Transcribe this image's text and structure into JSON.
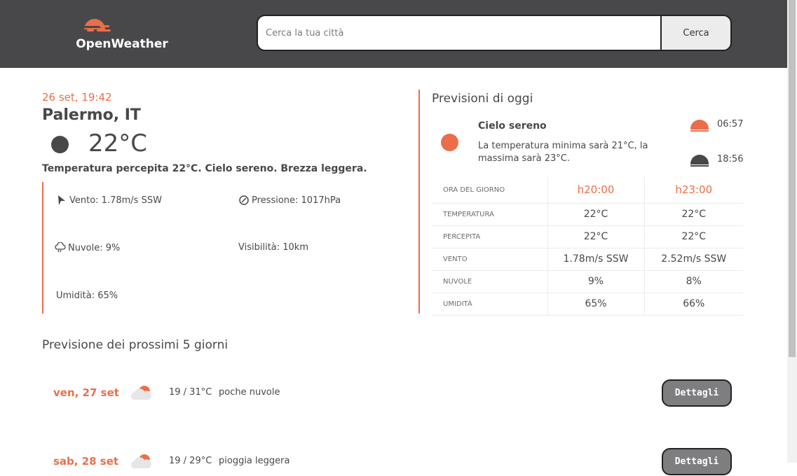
{
  "header": {
    "logo_text": "OpenWeather",
    "search_placeholder": "Cerca la tua città",
    "search_button": "Cerca"
  },
  "current": {
    "date": "26 set, 19:42",
    "city": "Palermo, IT",
    "temperature": "22°C",
    "description": "Temperatura percepita 22°C. Cielo sereno. Brezza leggera.",
    "wind": "Vento: 1.78m/s SSW",
    "pressure": "Pressione: 1017hPa",
    "clouds": "Nuvole: 9%",
    "visibility": "Visibilità: 10km",
    "humidity": "Umidità: 65%"
  },
  "today": {
    "title": "Previsioni di oggi",
    "summary": "Cielo sereno",
    "text": "La temperatura minima sarà 21°C, la massima sarà 23°C.",
    "sunrise": "06:57",
    "sunset": "18:56",
    "table": {
      "rows": [
        {
          "label": "ORA DEL GIORNO",
          "v1": "h20:00",
          "v2": "h23:00"
        },
        {
          "label": "TEMPERATURA",
          "v1": "22°C",
          "v2": "22°C"
        },
        {
          "label": "PERCEPITA",
          "v1": "22°C",
          "v2": "22°C"
        },
        {
          "label": "VENTO",
          "v1": "1.78m/s SSW",
          "v2": "2.52m/s SSW"
        },
        {
          "label": "NUVOLE",
          "v1": "9%",
          "v2": "8%"
        },
        {
          "label": "UMIDITÀ",
          "v1": "65%",
          "v2": "66%"
        }
      ]
    }
  },
  "forecast": {
    "title": "Previsione dei prossimi 5 giorni",
    "days": [
      {
        "date": "ven, 27 set",
        "temp": "19 / 31°C",
        "desc": "poche nuvole",
        "button": "Dettagli"
      },
      {
        "date": "sab, 28 set",
        "temp": "19 / 29°C",
        "desc": "pioggia leggera",
        "button": "Dettagli"
      }
    ]
  },
  "colors": {
    "accent": "#eb6e4b",
    "dark": "#48484a"
  }
}
